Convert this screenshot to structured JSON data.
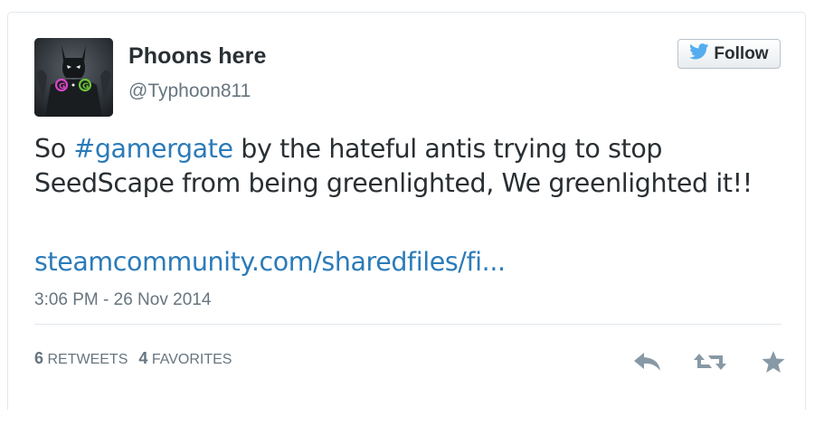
{
  "user": {
    "name": "Phoons here",
    "handle": "@Typhoon811",
    "avatar_badge": "G G"
  },
  "follow_button": {
    "label": "Follow",
    "icon": "twitter-bird-icon",
    "icon_color": "#55acee"
  },
  "tweet": {
    "prefix": "So ",
    "hashtag": "#gamergate",
    "body": " by the hateful antis trying to stop SeedScape from being greenlighted, We greenlighted it!!",
    "link": "steamcommunity.com/sharedfiles/fi...",
    "timestamp": "3:06 PM - 26 Nov 2014"
  },
  "stats": {
    "retweets_count": "6",
    "retweets_label": "RETWEETS",
    "favorites_count": "4",
    "favorites_label": "FAVORITES"
  },
  "actions": {
    "reply_icon": "reply-icon",
    "retweet_icon": "retweet-icon",
    "favorite_icon": "star-icon",
    "icon_color": "#8899a6"
  },
  "colors": {
    "link": "#2b7bb9",
    "text": "#292f33",
    "muted": "#66757f"
  }
}
